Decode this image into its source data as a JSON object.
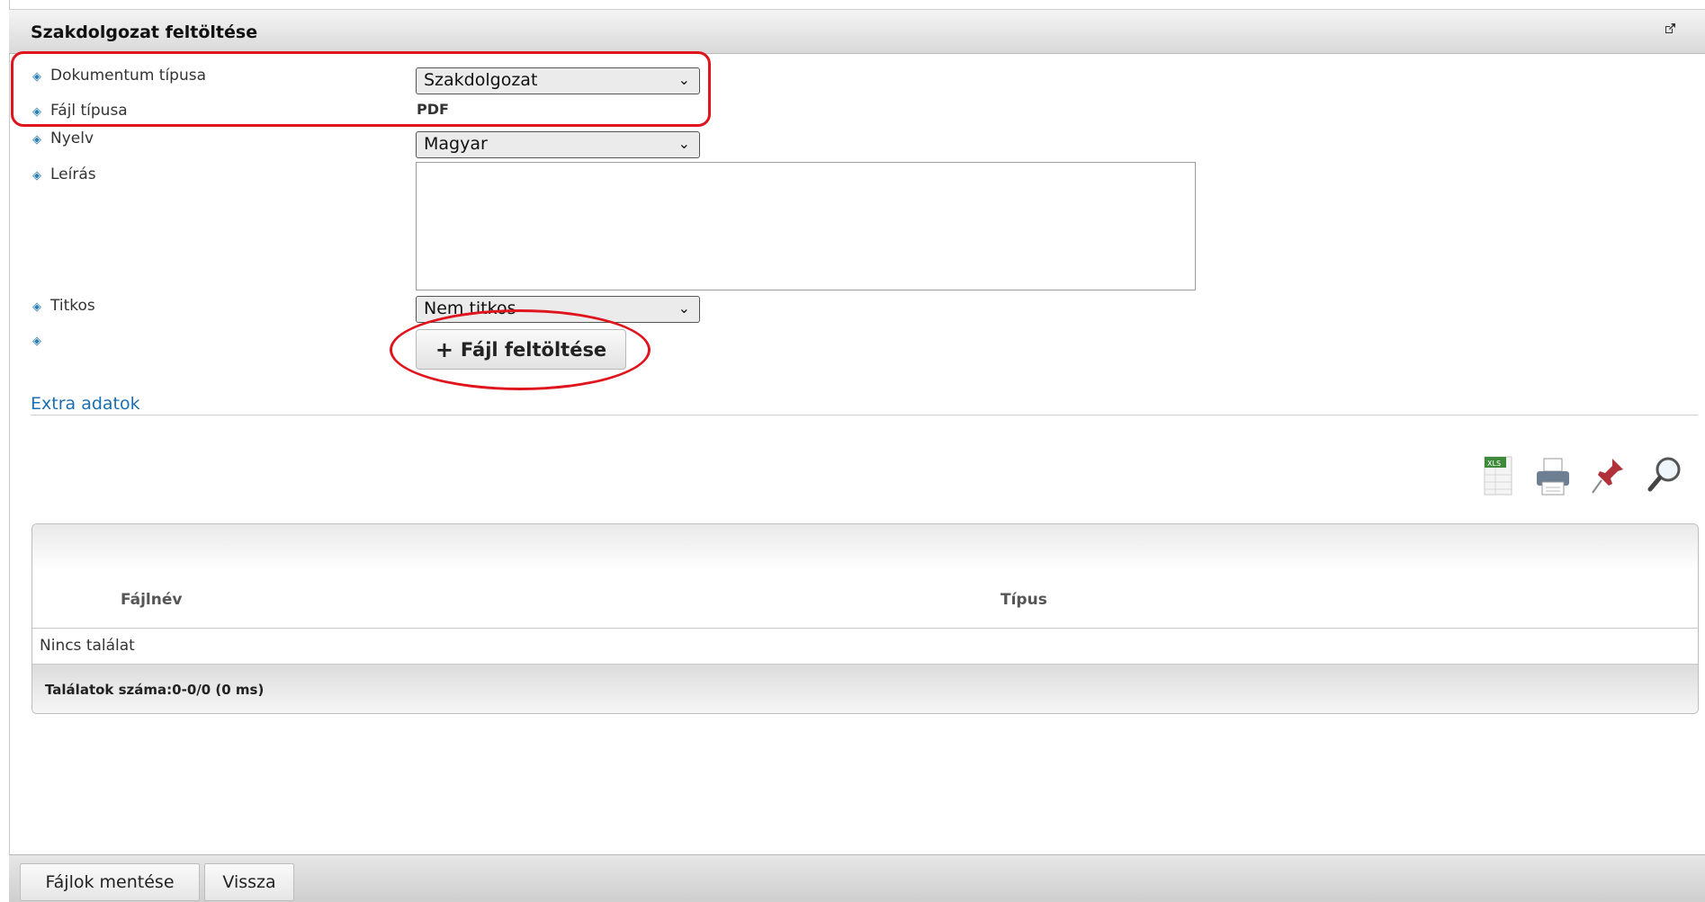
{
  "panel": {
    "title": "Szakdolgozat feltöltése",
    "popout_icon": "external-link-icon"
  },
  "form": {
    "document_type": {
      "label": "Dokumentum típusa",
      "value": "Szakdolgozat"
    },
    "file_type": {
      "label": "Fájl típusa",
      "value": "PDF"
    },
    "language": {
      "label": "Nyelv",
      "value": "Magyar"
    },
    "description": {
      "label": "Leírás",
      "value": ""
    },
    "secret": {
      "label": "Titkos",
      "value": "Nem titkos"
    },
    "upload_button": "Fájl feltöltése"
  },
  "extra_link": "Extra adatok",
  "toolbar": {
    "icons": [
      "xls-export-icon",
      "print-icon",
      "pin-icon",
      "search-icon"
    ]
  },
  "grid": {
    "columns": [
      "Fájlnév",
      "Típus"
    ],
    "empty_text": "Nincs találat",
    "footer": "Találatok száma:0-0/0 (0 ms)"
  },
  "bottom": {
    "save_label": "Fájlok mentése",
    "back_label": "Vissza"
  },
  "colors": {
    "highlight": "#e0141c",
    "link": "#1a6fb3"
  }
}
